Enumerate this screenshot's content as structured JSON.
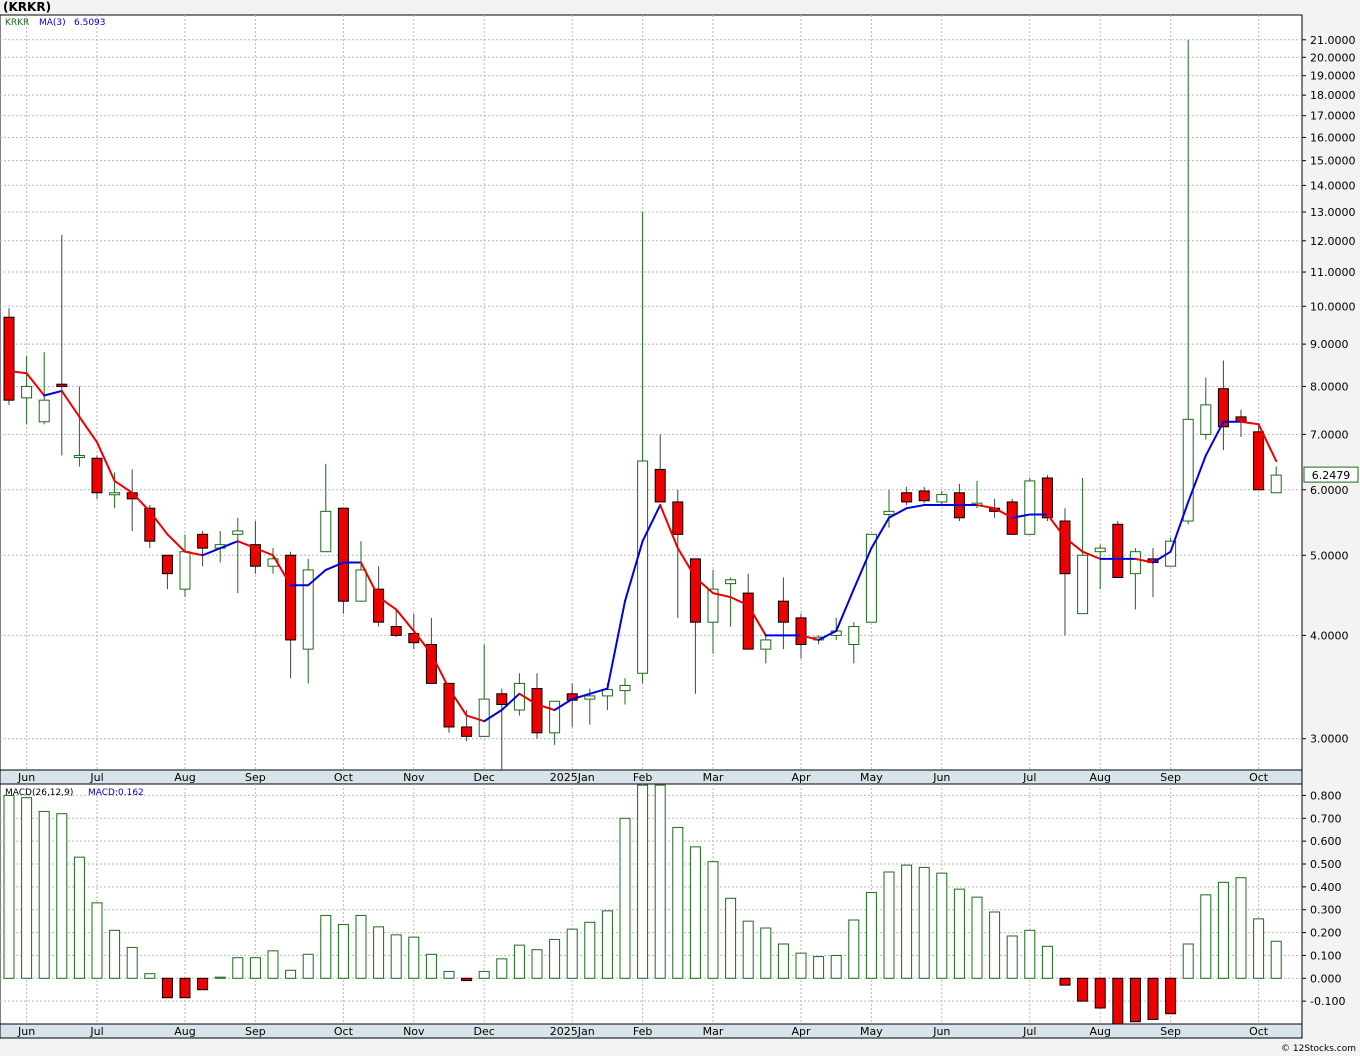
{
  "header": {
    "ticker_title": "(KRKR)",
    "legend_ticker": "KRKR",
    "legend_ma_label": "MA(3)",
    "legend_ma_value": "6.5093",
    "last_price_tag": "6.2479"
  },
  "macd_panel": {
    "label": "MACD(26,12,9)",
    "value_label": "MACD:0.162"
  },
  "footer": {
    "copyright": "© 12Stocks.com"
  },
  "colors": {
    "up_candle_stroke": "#1a6b1a",
    "down_candle_fill": "#ee0000",
    "ma_rising": "#0000dd",
    "ma_falling": "#ee0000",
    "grid": "#b8b8b8",
    "axis_band": "#d8e4ea",
    "macd_positive_stroke": "#1a6b1a",
    "macd_negative_fill": "#ee0000"
  },
  "chart_data": [
    {
      "type": "candlestick",
      "title": "(KRKR)",
      "y_scale": "log",
      "ylim": [
        2.75,
        22.5
      ],
      "y_ticks": [
        3.0,
        4.0,
        5.0,
        6.0,
        7.0,
        8.0,
        9.0,
        10.0,
        11.0,
        12.0,
        13.0,
        14.0,
        15.0,
        16.0,
        17.0,
        18.0,
        19.0,
        20.0,
        21.0
      ],
      "y_tick_labels": [
        "3.0000",
        "4.0000",
        "5.0000",
        "6.0000",
        "7.0000",
        "8.0000",
        "9.0000",
        "10.0000",
        "11.0000",
        "12.0000",
        "13.0000",
        "14.0000",
        "15.0000",
        "16.0000",
        "17.0000",
        "18.0000",
        "19.0000",
        "20.0000",
        "21.0000"
      ],
      "x_month_labels": [
        {
          "label": "Jun",
          "week": 1
        },
        {
          "label": "Jul",
          "week": 5
        },
        {
          "label": "Aug",
          "week": 10
        },
        {
          "label": "Sep",
          "week": 14
        },
        {
          "label": "Oct",
          "week": 19
        },
        {
          "label": "Nov",
          "week": 23
        },
        {
          "label": "Dec",
          "week": 27
        },
        {
          "label": "2025Jan",
          "week": 32
        },
        {
          "label": "Feb",
          "week": 36
        },
        {
          "label": "Mar",
          "week": 40
        },
        {
          "label": "Apr",
          "week": 45
        },
        {
          "label": "May",
          "week": 49
        },
        {
          "label": "Jun",
          "week": 53
        },
        {
          "label": "Jul",
          "week": 58
        },
        {
          "label": "Aug",
          "week": 62
        },
        {
          "label": "Sep",
          "week": 66
        },
        {
          "label": "Oct",
          "week": 71
        }
      ],
      "candles": [
        {
          "o": 9.7,
          "h": 9.95,
          "l": 7.6,
          "c": 7.7
        },
        {
          "o": 7.75,
          "h": 8.7,
          "l": 7.2,
          "c": 8.0
        },
        {
          "o": 7.25,
          "h": 8.8,
          "l": 7.2,
          "c": 7.7
        },
        {
          "o": 8.05,
          "h": 12.2,
          "l": 6.6,
          "c": 8.0
        },
        {
          "o": 6.6,
          "h": 8.0,
          "l": 6.4,
          "c": 6.6
        },
        {
          "o": 6.55,
          "h": 6.6,
          "l": 5.85,
          "c": 5.95
        },
        {
          "o": 5.95,
          "h": 6.3,
          "l": 5.7,
          "c": 5.95
        },
        {
          "o": 5.95,
          "h": 6.35,
          "l": 5.35,
          "c": 5.85
        },
        {
          "o": 5.7,
          "h": 5.75,
          "l": 5.1,
          "c": 5.2
        },
        {
          "o": 5.0,
          "h": 5.0,
          "l": 4.55,
          "c": 4.75
        },
        {
          "o": 4.55,
          "h": 5.3,
          "l": 4.45,
          "c": 5.05
        },
        {
          "o": 5.3,
          "h": 5.35,
          "l": 4.85,
          "c": 5.1
        },
        {
          "o": 5.1,
          "h": 5.35,
          "l": 4.9,
          "c": 5.15
        },
        {
          "o": 5.3,
          "h": 5.55,
          "l": 4.5,
          "c": 5.35
        },
        {
          "o": 5.15,
          "h": 5.5,
          "l": 4.75,
          "c": 4.85
        },
        {
          "o": 4.85,
          "h": 5.1,
          "l": 4.75,
          "c": 4.95
        },
        {
          "o": 5.0,
          "h": 5.05,
          "l": 3.55,
          "c": 3.95
        },
        {
          "o": 3.85,
          "h": 4.95,
          "l": 3.5,
          "c": 4.8
        },
        {
          "o": 5.05,
          "h": 6.45,
          "l": 5.05,
          "c": 5.65
        },
        {
          "o": 5.7,
          "h": 5.7,
          "l": 4.25,
          "c": 4.4
        },
        {
          "o": 4.4,
          "h": 5.2,
          "l": 4.4,
          "c": 4.8
        },
        {
          "o": 4.55,
          "h": 4.85,
          "l": 4.1,
          "c": 4.15
        },
        {
          "o": 4.1,
          "h": 4.3,
          "l": 3.98,
          "c": 4.0
        },
        {
          "o": 4.02,
          "h": 4.25,
          "l": 3.85,
          "c": 3.92
        },
        {
          "o": 3.9,
          "h": 4.2,
          "l": 3.5,
          "c": 3.5
        },
        {
          "o": 3.5,
          "h": 3.5,
          "l": 3.05,
          "c": 3.1
        },
        {
          "o": 3.1,
          "h": 3.25,
          "l": 2.98,
          "c": 3.02
        },
        {
          "o": 3.02,
          "h": 3.9,
          "l": 3.02,
          "c": 3.35
        },
        {
          "o": 3.4,
          "h": 3.45,
          "l": 2.75,
          "c": 3.3
        },
        {
          "o": 3.25,
          "h": 3.6,
          "l": 3.2,
          "c": 3.5
        },
        {
          "o": 3.45,
          "h": 3.6,
          "l": 3.0,
          "c": 3.05
        },
        {
          "o": 3.05,
          "h": 3.3,
          "l": 2.95,
          "c": 3.33
        },
        {
          "o": 3.4,
          "h": 3.5,
          "l": 3.1,
          "c": 3.34
        },
        {
          "o": 3.35,
          "h": 3.45,
          "l": 3.12,
          "c": 3.38
        },
        {
          "o": 3.38,
          "h": 3.5,
          "l": 3.25,
          "c": 3.44
        },
        {
          "o": 3.43,
          "h": 3.55,
          "l": 3.3,
          "c": 3.48
        },
        {
          "o": 3.6,
          "h": 13.0,
          "l": 3.5,
          "c": 6.5
        },
        {
          "o": 6.35,
          "h": 7.0,
          "l": 5.8,
          "c": 5.8
        },
        {
          "o": 5.8,
          "h": 6.0,
          "l": 4.2,
          "c": 5.3
        },
        {
          "o": 4.95,
          "h": 4.95,
          "l": 3.4,
          "c": 4.15
        },
        {
          "o": 4.15,
          "h": 4.8,
          "l": 3.8,
          "c": 4.55
        },
        {
          "o": 4.62,
          "h": 4.7,
          "l": 4.1,
          "c": 4.67
        },
        {
          "o": 4.5,
          "h": 4.75,
          "l": 3.85,
          "c": 3.85
        },
        {
          "o": 3.85,
          "h": 4.0,
          "l": 3.7,
          "c": 3.95
        },
        {
          "o": 4.4,
          "h": 4.7,
          "l": 3.85,
          "c": 4.15
        },
        {
          "o": 4.2,
          "h": 4.25,
          "l": 3.75,
          "c": 3.9
        },
        {
          "o": 3.95,
          "h": 4.0,
          "l": 3.9,
          "c": 3.98
        },
        {
          "o": 4.0,
          "h": 4.2,
          "l": 3.95,
          "c": 4.05
        },
        {
          "o": 3.9,
          "h": 4.15,
          "l": 3.7,
          "c": 4.1
        },
        {
          "o": 4.15,
          "h": 5.3,
          "l": 4.15,
          "c": 5.3
        },
        {
          "o": 5.6,
          "h": 6.0,
          "l": 5.4,
          "c": 5.65
        },
        {
          "o": 5.95,
          "h": 6.05,
          "l": 5.75,
          "c": 5.8
        },
        {
          "o": 5.98,
          "h": 6.05,
          "l": 5.78,
          "c": 5.82
        },
        {
          "o": 5.8,
          "h": 5.98,
          "l": 5.75,
          "c": 5.92
        },
        {
          "o": 5.95,
          "h": 6.1,
          "l": 5.5,
          "c": 5.55
        },
        {
          "o": 5.75,
          "h": 6.15,
          "l": 5.7,
          "c": 5.78
        },
        {
          "o": 5.7,
          "h": 5.85,
          "l": 5.55,
          "c": 5.65
        },
        {
          "o": 5.8,
          "h": 5.85,
          "l": 5.3,
          "c": 5.3
        },
        {
          "o": 5.3,
          "h": 6.2,
          "l": 5.3,
          "c": 6.15
        },
        {
          "o": 6.2,
          "h": 6.25,
          "l": 5.5,
          "c": 5.55
        },
        {
          "o": 5.5,
          "h": 5.7,
          "l": 4.0,
          "c": 4.75
        },
        {
          "o": 4.25,
          "h": 6.2,
          "l": 4.25,
          "c": 5.0
        },
        {
          "o": 5.05,
          "h": 5.15,
          "l": 4.55,
          "c": 5.1
        },
        {
          "o": 5.45,
          "h": 5.5,
          "l": 4.7,
          "c": 4.7
        },
        {
          "o": 4.75,
          "h": 5.1,
          "l": 4.3,
          "c": 5.05
        },
        {
          "o": 4.95,
          "h": 5.1,
          "l": 4.45,
          "c": 4.9
        },
        {
          "o": 4.85,
          "h": 5.25,
          "l": 4.85,
          "c": 5.2
        },
        {
          "o": 5.5,
          "h": 21.0,
          "l": 5.45,
          "c": 7.3
        },
        {
          "o": 7.0,
          "h": 8.2,
          "l": 6.9,
          "c": 7.6
        },
        {
          "o": 7.95,
          "h": 8.6,
          "l": 6.7,
          "c": 7.15
        },
        {
          "o": 7.35,
          "h": 7.5,
          "l": 6.95,
          "c": 7.25
        },
        {
          "o": 7.05,
          "h": 7.2,
          "l": 6.0,
          "c": 6.0
        },
        {
          "o": 5.95,
          "h": 6.4,
          "l": 5.95,
          "c": 6.25
        }
      ],
      "moving_average": {
        "name": "MA(3)",
        "values": [
          8.35,
          8.3,
          7.8,
          7.9,
          7.35,
          6.85,
          6.15,
          5.95,
          5.65,
          5.3,
          5.05,
          5.0,
          5.1,
          5.2,
          5.1,
          5.0,
          4.6,
          4.6,
          4.8,
          4.9,
          4.9,
          4.45,
          4.3,
          4.05,
          3.8,
          3.45,
          3.2,
          3.15,
          3.25,
          3.4,
          3.3,
          3.25,
          3.35,
          3.4,
          3.45,
          4.4,
          5.2,
          5.75,
          5.1,
          4.7,
          4.5,
          4.45,
          4.35,
          4.0,
          4.0,
          4.0,
          3.95,
          4.05,
          4.55,
          5.1,
          5.55,
          5.7,
          5.75,
          5.75,
          5.75,
          5.75,
          5.7,
          5.55,
          5.6,
          5.6,
          5.25,
          5.05,
          4.95,
          4.95,
          4.95,
          4.9,
          5.05,
          5.8,
          6.6,
          7.25,
          7.25,
          7.2,
          6.5
        ]
      }
    },
    {
      "type": "bar",
      "title": "MACD(26,12,9)",
      "ylim": [
        -0.2,
        0.85
      ],
      "y_ticks": [
        -0.1,
        0.0,
        0.1,
        0.2,
        0.3,
        0.4,
        0.5,
        0.6,
        0.7,
        0.8
      ],
      "y_tick_labels": [
        "-0.100",
        "0.000",
        "0.100",
        "0.200",
        "0.300",
        "0.400",
        "0.500",
        "0.600",
        "0.700",
        "0.800"
      ],
      "values": [
        0.8,
        0.79,
        0.73,
        0.72,
        0.53,
        0.33,
        0.21,
        0.135,
        0.02,
        -0.085,
        -0.085,
        -0.05,
        0.005,
        0.09,
        0.09,
        0.12,
        0.035,
        0.105,
        0.275,
        0.235,
        0.275,
        0.225,
        0.19,
        0.18,
        0.105,
        0.03,
        -0.01,
        0.03,
        0.085,
        0.145,
        0.125,
        0.17,
        0.215,
        0.245,
        0.295,
        0.7,
        0.845,
        0.845,
        0.66,
        0.575,
        0.51,
        0.35,
        0.25,
        0.22,
        0.15,
        0.11,
        0.095,
        0.1,
        0.255,
        0.375,
        0.465,
        0.495,
        0.485,
        0.46,
        0.39,
        0.355,
        0.29,
        0.185,
        0.21,
        0.14,
        -0.03,
        -0.1,
        -0.13,
        -0.2,
        -0.19,
        -0.18,
        -0.155,
        0.15,
        0.365,
        0.42,
        0.44,
        0.26,
        0.162
      ]
    }
  ]
}
